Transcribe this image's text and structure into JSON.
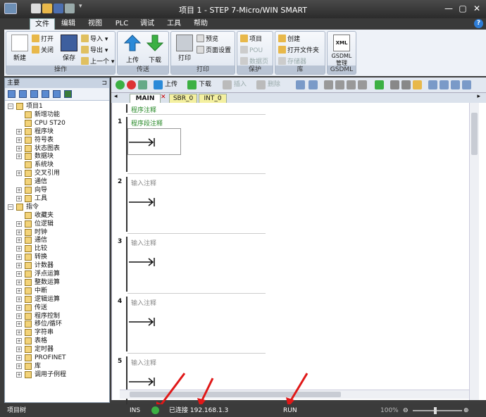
{
  "window": {
    "title": "项目 1 - STEP 7-Micro/WIN SMART",
    "min": "—",
    "max": "▢",
    "close": "✕"
  },
  "menu": {
    "tabs": [
      "文件",
      "编辑",
      "视图",
      "PLC",
      "调试",
      "工具",
      "帮助"
    ],
    "active": "文件",
    "help": "?"
  },
  "ribbon": {
    "groups": [
      {
        "caption": "操作"
      },
      {
        "caption": "传送"
      },
      {
        "caption": "打印"
      },
      {
        "caption": "保护"
      },
      {
        "caption": "库"
      },
      {
        "caption": "GSDML"
      }
    ],
    "new": "新建",
    "open": "打开",
    "close": "关闭",
    "save": "保存",
    "import": "导入",
    "export": "导出",
    "last": "上一个",
    "upload": "上传",
    "download": "下载",
    "print": "打印",
    "preview": "预览",
    "page_setup": "页面设置",
    "project": "项目",
    "pou": "POU",
    "data_page": "数据页",
    "create": "创建",
    "open_folder": "打开文件夹",
    "memory": "存储器",
    "xml": "XML",
    "gsdml_manage_1": "GSDML",
    "gsdml_manage_2": "管理"
  },
  "left_panel": {
    "header": "主要",
    "pin": "⊐",
    "tree": [
      {
        "label": "项目1",
        "level": 0,
        "box": "−"
      },
      {
        "label": "新增功能",
        "level": 1,
        "box": ""
      },
      {
        "label": "CPU ST20",
        "level": 1,
        "box": ""
      },
      {
        "label": "程序块",
        "level": 1,
        "box": "+"
      },
      {
        "label": "符号表",
        "level": 1,
        "box": "+"
      },
      {
        "label": "状态图表",
        "level": 1,
        "box": "+"
      },
      {
        "label": "数据块",
        "level": 1,
        "box": "+"
      },
      {
        "label": "系统块",
        "level": 1,
        "box": ""
      },
      {
        "label": "交叉引用",
        "level": 1,
        "box": "+"
      },
      {
        "label": "通信",
        "level": 1,
        "box": ""
      },
      {
        "label": "向导",
        "level": 1,
        "box": "+"
      },
      {
        "label": "工具",
        "level": 1,
        "box": "+"
      },
      {
        "label": "指令",
        "level": 0,
        "box": "−"
      },
      {
        "label": "收藏夹",
        "level": 1,
        "box": ""
      },
      {
        "label": "位逻辑",
        "level": 1,
        "box": "+"
      },
      {
        "label": "时钟",
        "level": 1,
        "box": "+"
      },
      {
        "label": "通信",
        "level": 1,
        "box": "+"
      },
      {
        "label": "比较",
        "level": 1,
        "box": "+"
      },
      {
        "label": "转换",
        "level": 1,
        "box": "+"
      },
      {
        "label": "计数器",
        "level": 1,
        "box": "+"
      },
      {
        "label": "浮点运算",
        "level": 1,
        "box": "+"
      },
      {
        "label": "整数运算",
        "level": 1,
        "box": "+"
      },
      {
        "label": "中断",
        "level": 1,
        "box": "+"
      },
      {
        "label": "逻辑运算",
        "level": 1,
        "box": "+"
      },
      {
        "label": "传送",
        "level": 1,
        "box": "+"
      },
      {
        "label": "程序控制",
        "level": 1,
        "box": "+"
      },
      {
        "label": "移位/循环",
        "level": 1,
        "box": "+"
      },
      {
        "label": "字符串",
        "level": 1,
        "box": "+"
      },
      {
        "label": "表格",
        "level": 1,
        "box": "+"
      },
      {
        "label": "定时器",
        "level": 1,
        "box": "+"
      },
      {
        "label": "PROFINET",
        "level": 1,
        "box": "+"
      },
      {
        "label": "库",
        "level": 1,
        "box": "+"
      },
      {
        "label": "调用子例程",
        "level": 1,
        "box": "+"
      }
    ]
  },
  "editor": {
    "toolbar": {
      "upload": "上传",
      "download": "下载",
      "insert": "插入",
      "delete": "删除"
    },
    "tabs": [
      "MAIN",
      "SBR_0",
      "INT_0"
    ],
    "active_tab": "MAIN",
    "program_comment": "程序注释",
    "networks": [
      {
        "num": "1",
        "comment": "程序段注释"
      },
      {
        "num": "2",
        "comment": "输入注释"
      },
      {
        "num": "3",
        "comment": "输入注释"
      },
      {
        "num": "4",
        "comment": "输入注释"
      },
      {
        "num": "5",
        "comment": "输入注释"
      }
    ]
  },
  "status_bar": {
    "tree": "项目树",
    "mode": "INS",
    "connection": "已连接 192.168.1.3",
    "run": "RUN",
    "zoom": "100%",
    "connected_color": "#3cb043"
  }
}
